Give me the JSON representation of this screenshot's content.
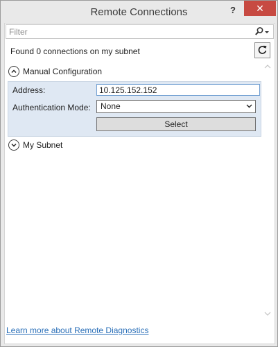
{
  "window": {
    "title": "Remote Connections",
    "help_label": "?",
    "close_label": "✕"
  },
  "filter": {
    "placeholder": "Filter",
    "value": ""
  },
  "status": {
    "found_text": "Found 0 connections on my subnet"
  },
  "manual_config": {
    "header": "Manual Configuration",
    "address_label": "Address:",
    "address_value": "10.125.152.152",
    "auth_label": "Authentication Mode:",
    "auth_value": "None",
    "select_label": "Select"
  },
  "subnet": {
    "header": "My Subnet"
  },
  "footer": {
    "learn_more": "Learn more about Remote Diagnostics"
  },
  "icons": {
    "search": "search-icon",
    "dropdown": "chevron-down-icon",
    "refresh": "refresh-icon",
    "collapse": "chevron-up-circle-icon",
    "expand": "chevron-down-circle-icon"
  },
  "colors": {
    "close_button": "#c74a42",
    "panel_background": "#dfe8f3",
    "link": "#2a6fb8",
    "input_focus_border": "#6f9ed1"
  }
}
